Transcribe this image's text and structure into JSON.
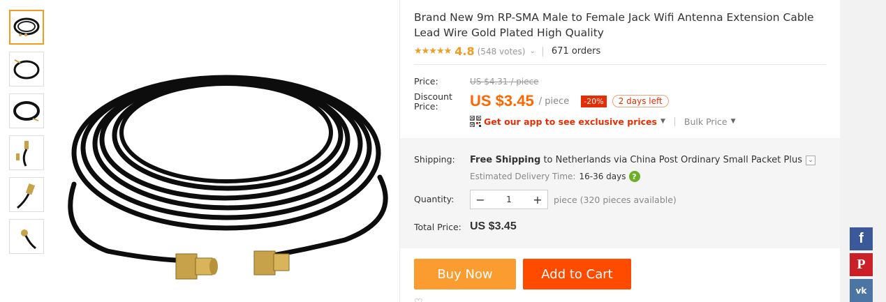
{
  "product": {
    "title": "Brand New 9m RP-SMA Male to Female Jack Wifi Antenna Extension Cable Lead Wire Gold Plated High Quality",
    "rating": {
      "stars": "★★★★★",
      "value": "4.8",
      "votes": "(548 votes)",
      "orders": "671 orders"
    }
  },
  "pricing": {
    "price_label": "Price:",
    "old_price": "US $4.31 / piece",
    "discount_label_line1": "Discount",
    "discount_label_line2": "Price:",
    "current_price": "US $3.45",
    "unit": "/ piece",
    "discount_badge": "-20%",
    "days_left": "2 days left",
    "app_promo": "Get our app to see exclusive prices",
    "bulk_price": "Bulk Price"
  },
  "shipping": {
    "label": "Shipping:",
    "free_shipping": "Free Shipping",
    "destination_text": " to Netherlands via China Post Ordinary Small Packet Plus",
    "estimated_label": "Estimated Delivery Time:",
    "estimated_days": "16-36 days"
  },
  "quantity": {
    "label": "Quantity:",
    "value": "1",
    "minus": "−",
    "plus": "+",
    "available": "piece (320 pieces available)"
  },
  "total": {
    "label": "Total Price:",
    "value": "US $3.45"
  },
  "actions": {
    "buy_now": "Buy Now",
    "add_to_cart": "Add to Cart"
  },
  "social": {
    "facebook": "f",
    "pinterest": "P",
    "vk": "vk"
  },
  "colors": {
    "accent_orange": "#f60",
    "rating_orange": "#f29b21",
    "discount_red": "#e62e04",
    "buy_now": "#fa9c30",
    "add_to_cart": "#ff4b00"
  }
}
